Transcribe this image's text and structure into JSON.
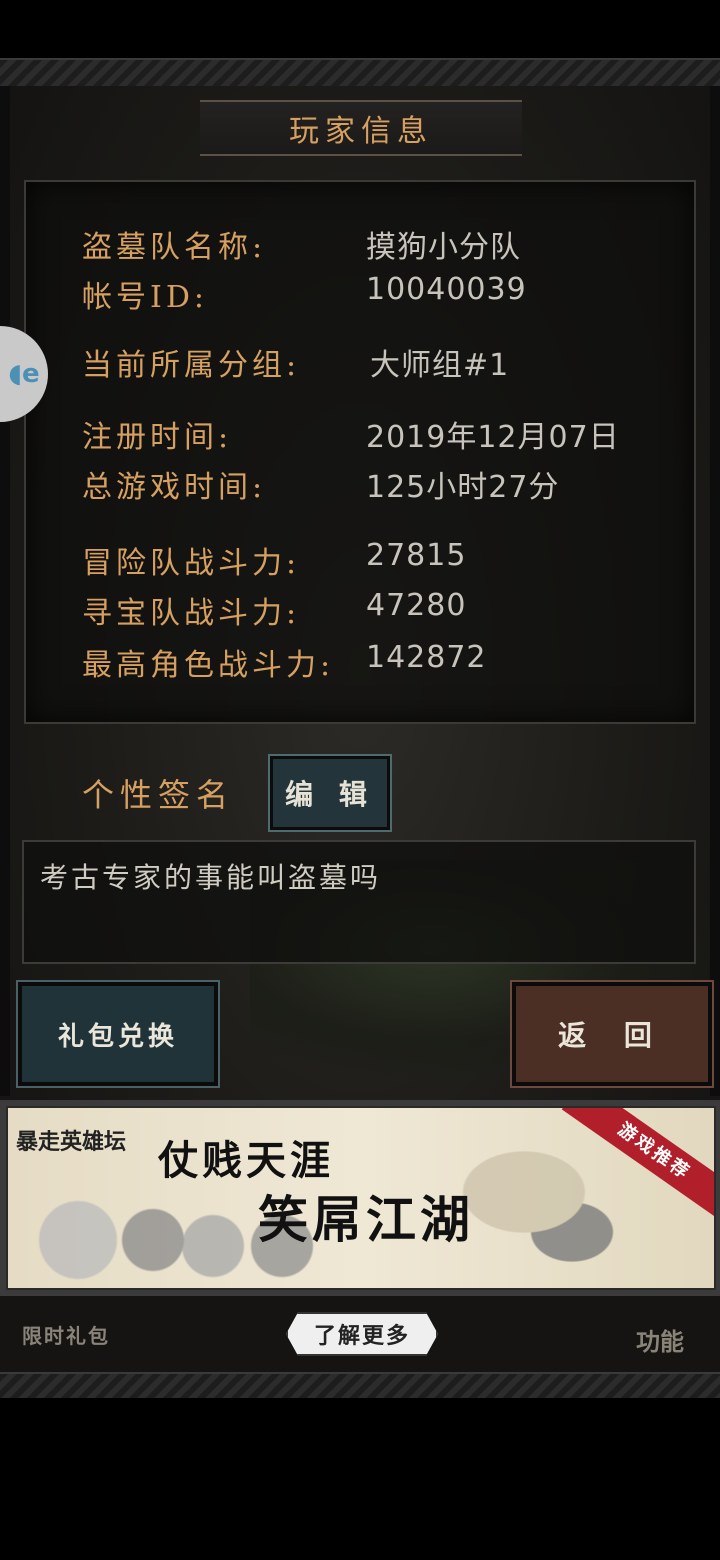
{
  "title": "玩家信息",
  "info": {
    "team_name": {
      "label": "盗墓队名称:",
      "value": "摸狗小分队"
    },
    "account_id": {
      "label": "帐号ID:",
      "value": "10040039"
    },
    "group": {
      "label": "当前所属分组:",
      "value": "大师组#1"
    },
    "register_time": {
      "label": "注册时间:",
      "value": "2019年12月07日"
    },
    "play_time": {
      "label": "总游戏时间:",
      "value": "125小时27分"
    },
    "adventure_power": {
      "label": "冒险队战斗力:",
      "value": "27815"
    },
    "treasure_power": {
      "label": "寻宝队战斗力:",
      "value": "47280"
    },
    "top_role_power": {
      "label": "最高角色战斗力:",
      "value": "142872"
    }
  },
  "signature": {
    "label": "个性签名",
    "edit_label": "编 辑",
    "text": "考古专家的事能叫盗墓吗"
  },
  "buttons": {
    "gift_exchange": "礼包兑换",
    "back": "返 回"
  },
  "ad": {
    "brand": "暴走英雄坛",
    "line1": "仗贱天涯",
    "line2": "笑屌江湖",
    "ribbon": "游戏推荐",
    "learn_more": "了解更多"
  },
  "bottom": {
    "left_label": "限时礼包",
    "right_label": "功能"
  },
  "colors": {
    "label_gold": "#d6a061",
    "value_gray": "#c8c4bb",
    "edit_teal": "#23353a",
    "back_brown": "#4b2e24"
  }
}
